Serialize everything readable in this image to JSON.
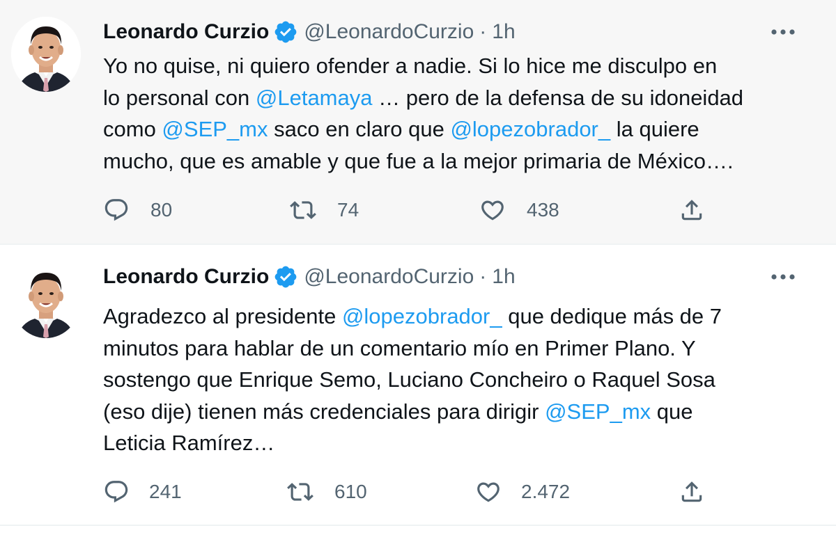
{
  "tweets": [
    {
      "author_name": "Leonardo Curzio",
      "handle": "@LeonardoCurzio",
      "separator": "·",
      "time": "1h",
      "lines": [
        [
          {
            "t": "Yo no quise, ni quiero ofender a nadie. Si lo hice me disculpo en"
          }
        ],
        [
          {
            "t": "lo personal con "
          },
          {
            "t": "@Letamaya",
            "m": true
          },
          {
            "t": " … pero de la defensa de su idoneidad"
          }
        ],
        [
          {
            "t": "como "
          },
          {
            "t": "@SEP_mx",
            "m": true
          },
          {
            "t": " saco en claro que "
          },
          {
            "t": "@lopezobrador_",
            "m": true
          },
          {
            "t": " la quiere"
          }
        ],
        [
          {
            "t": "mucho, que es amable y que fue a la mejor primaria de México…."
          }
        ]
      ],
      "replies": "80",
      "retweets": "74",
      "likes": "438",
      "icons": {
        "reply": "reply-icon",
        "retweet": "retweet-icon",
        "like": "heart-icon",
        "share": "share-icon"
      }
    },
    {
      "author_name": "Leonardo Curzio",
      "handle": "@LeonardoCurzio",
      "separator": "·",
      "time": "1h",
      "lines": [
        [
          {
            "t": "Agradezco al presidente "
          },
          {
            "t": "@lopezobrador_",
            "m": true
          },
          {
            "t": " que dedique más de 7"
          }
        ],
        [
          {
            "t": "minutos para hablar de un comentario mío en Primer Plano. Y"
          }
        ],
        [
          {
            "t": "sostengo que Enrique Semo, Luciano Concheiro o Raquel Sosa"
          }
        ],
        [
          {
            "t": "(eso dije) tienen más credenciales para dirigir "
          },
          {
            "t": "@SEP_mx",
            "m": true
          },
          {
            "t": " que"
          }
        ],
        [
          {
            "t": "Leticia Ramírez…"
          }
        ]
      ],
      "replies": "241",
      "retweets": "610",
      "likes": "2.472",
      "icons": {
        "reply": "reply-icon",
        "retweet": "retweet-icon",
        "like": "heart-icon",
        "share": "share-icon"
      }
    }
  ],
  "colors": {
    "link": "#1d9bf0",
    "verified_badge": "#1d9bf0",
    "secondary_text": "#536471",
    "primary_text": "#0f1419",
    "first_tweet_background": "#f7f7f7"
  }
}
